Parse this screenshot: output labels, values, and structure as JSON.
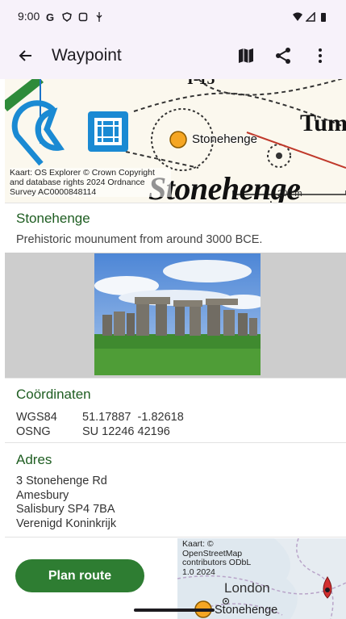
{
  "status_bar": {
    "time": "9:00"
  },
  "app_bar": {
    "title": "Waypoint"
  },
  "map_top": {
    "attribution": "Kaart: OS Explorer © Crown Copyright and database rights 2024 Ordnance Survey AC0000848114",
    "marker_label": "Stonehenge",
    "area_label": "Stonehenge",
    "tum_label": "Tum",
    "scale_label": "200 m"
  },
  "waypoint": {
    "name": "Stonehenge",
    "description": "Prehistoric mounument from around 3000 BCE."
  },
  "coordinates": {
    "heading": "Coördinaten",
    "rows": [
      {
        "label": "WGS84",
        "value": "51.17887  -1.82618"
      },
      {
        "label": "OSNG",
        "value": "SU 12246 42196"
      }
    ]
  },
  "address": {
    "heading": "Adres",
    "lines": [
      "3 Stonehenge Rd",
      "Amesbury",
      "Salisbury SP4 7BA",
      "Verenigd Koninkrijk"
    ]
  },
  "actions": {
    "plan_route": "Plan route"
  },
  "map_bottom": {
    "attribution": "Kaart: © OpenStreetMap contributors ODbL 1.0 2024",
    "city_label": "London",
    "marker_label": "Stonehenge"
  },
  "colors": {
    "accent_green": "#2e7d32",
    "heading_green": "#1e5d21",
    "marker_orange": "#f5a623",
    "pin_red": "#d32f2f"
  }
}
